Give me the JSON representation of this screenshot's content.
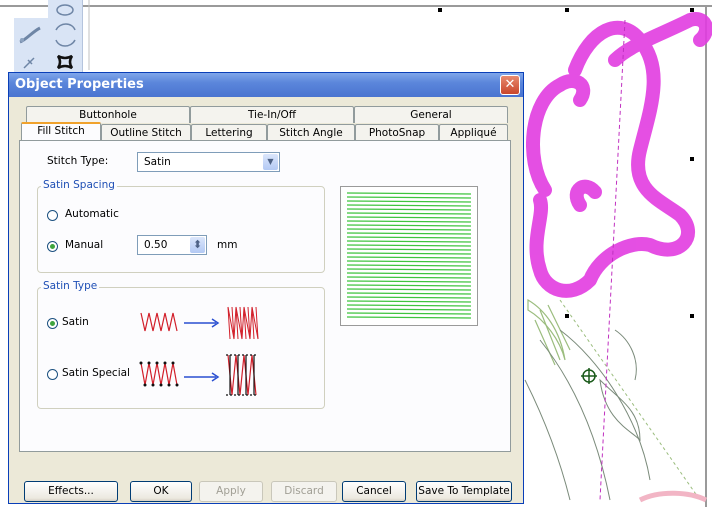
{
  "dialog": {
    "title": "Object Properties",
    "close_glyph": "✕"
  },
  "tabs_row1": [
    "Buttonhole",
    "Tie-In/Off",
    "General"
  ],
  "tabs_row2": [
    "Fill Stitch",
    "Outline Stitch",
    "Lettering",
    "Stitch Angle",
    "PhotoSnap",
    "Appliqué"
  ],
  "active_tab": "Fill Stitch",
  "stitch_type": {
    "label": "Stitch Type:",
    "value": "Satin",
    "arrow": "▼"
  },
  "satin_spacing": {
    "legend": "Satin Spacing",
    "automatic_label": "Automatic",
    "manual_label": "Manual",
    "selected": "Manual",
    "value": "0.50",
    "unit": "mm",
    "spin_glyph": "⬍"
  },
  "satin_type": {
    "legend": "Satin Type",
    "satin_label": "Satin",
    "special_label": "Satin Special",
    "selected": "Satin"
  },
  "buttons": {
    "effects": "Effects...",
    "ok": "OK",
    "apply": "Apply",
    "discard": "Discard",
    "cancel": "Cancel",
    "save_template": "Save To Template"
  },
  "colors": {
    "magenta": "#e23ce0",
    "green_stitch": "#3ec43e",
    "red_stitch": "#d21f2a",
    "arrow_blue": "#2a4fd1"
  },
  "icons": [
    "wand-icon",
    "rotate-icon",
    "feather-icon",
    "quatrefoil-icon",
    "crosshair-icon",
    "close-icon",
    "spin-arrows-icon",
    "dropdown-arrow-icon"
  ]
}
